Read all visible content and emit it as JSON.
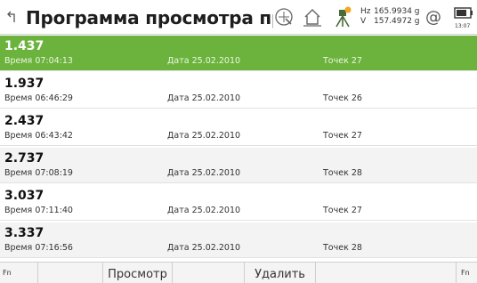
{
  "header": {
    "title": "Программа просмотра прос",
    "hz_label": "Hz",
    "hz_value": "165.9934 g",
    "v_label": "V",
    "v_value": "157.4972 g",
    "at_symbol": "@",
    "battery_time": "13:07",
    "icons": [
      "back-icon",
      "scan-target-icon",
      "home-icon",
      "tripod-icon",
      "at-icon",
      "battery-icon"
    ],
    "accent_dot_color": "#f5a623"
  },
  "list": {
    "selected_color": "#6cb33e",
    "rows": [
      {
        "number": "1.437",
        "time_label": "Время",
        "time": "07:04:13",
        "date_label": "Дата",
        "date": "25.02.2010",
        "points_label": "Точек",
        "points": "27",
        "selected": true
      },
      {
        "number": "1.937",
        "time_label": "Время",
        "time": "06:46:29",
        "date_label": "Дата",
        "date": "25.02.2010",
        "points_label": "Точек",
        "points": "26",
        "selected": false
      },
      {
        "number": "2.437",
        "time_label": "Время",
        "time": "06:43:42",
        "date_label": "Дата",
        "date": "25.02.2010",
        "points_label": "Точек",
        "points": "27",
        "selected": false
      },
      {
        "number": "2.737",
        "time_label": "Время",
        "time": "07:08:19",
        "date_label": "Дата",
        "date": "25.02.2010",
        "points_label": "Точек",
        "points": "28",
        "selected": false
      },
      {
        "number": "3.037",
        "time_label": "Время",
        "time": "07:11:40",
        "date_label": "Дата",
        "date": "25.02.2010",
        "points_label": "Точек",
        "points": "27",
        "selected": false
      },
      {
        "number": "3.337",
        "time_label": "Время",
        "time": "07:16:56",
        "date_label": "Дата",
        "date": "25.02.2010",
        "points_label": "Точек",
        "points": "28",
        "selected": false
      }
    ]
  },
  "footer": {
    "fn_left": "Fn",
    "fn_right": "Fn",
    "view_label": "Просмотр",
    "delete_label": "Удалить"
  }
}
